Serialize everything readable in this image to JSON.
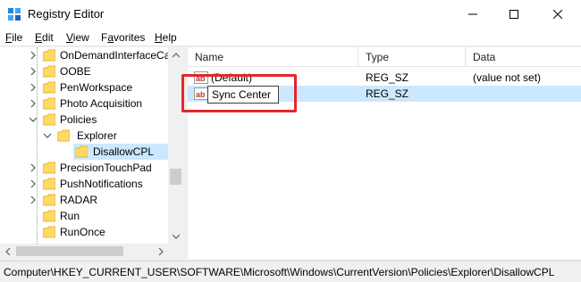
{
  "window": {
    "title": "Registry Editor"
  },
  "menu": [
    "File",
    "Edit",
    "View",
    "Favorites",
    "Help"
  ],
  "menu_underline": [
    "F",
    "E",
    "V",
    "a",
    "H"
  ],
  "tree": [
    {
      "label": "OnDemandInterfaceCa",
      "arrow": "right"
    },
    {
      "label": "OOBE",
      "arrow": "right"
    },
    {
      "label": "PenWorkspace",
      "arrow": "right"
    },
    {
      "label": "Photo Acquisition",
      "arrow": "right"
    },
    {
      "label": "Policies",
      "arrow": "down"
    },
    {
      "label": "Explorer",
      "arrow": "down"
    },
    {
      "label": "DisallowCPL",
      "arrow": "none",
      "selected": true
    },
    {
      "label": "PrecisionTouchPad",
      "arrow": "right"
    },
    {
      "label": "PushNotifications",
      "arrow": "right"
    },
    {
      "label": "RADAR",
      "arrow": "right"
    },
    {
      "label": "Run",
      "arrow": "none"
    },
    {
      "label": "RunOnce",
      "arrow": "none"
    }
  ],
  "list": {
    "columns": [
      "Name",
      "Type",
      "Data"
    ],
    "rows": [
      {
        "name": "(Default)",
        "type": "REG_SZ",
        "data": "(value not set)"
      },
      {
        "name": "Sync Center",
        "type": "REG_SZ",
        "data": "",
        "editing": true
      }
    ]
  },
  "rename_value": "Sync Center",
  "status": {
    "path": "Computer\\HKEY_CURRENT_USER\\SOFTWARE\\Microsoft\\Windows\\CurrentVersion\\Policies\\Explorer\\DisallowCPL"
  },
  "colors": {
    "selection": "#cce8ff",
    "folder": "#ffd866",
    "folder_dark": "#e8b43c",
    "callout": "#e5252a",
    "ab_icon": "#c0392b"
  }
}
